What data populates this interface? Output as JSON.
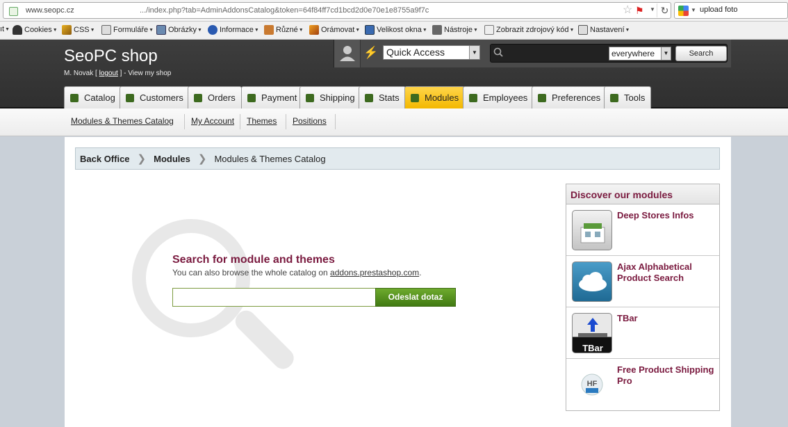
{
  "browser": {
    "url_host": "www.seopc.cz",
    "url_path": ".../index.php?tab=AdminAddonsCatalog&token=64f84ff7cd1bcd2d0e70e1e8755a9f7c",
    "search_text": "upload foto"
  },
  "toolbar": {
    "items": [
      "Cookies",
      "CSS",
      "Formuláře",
      "Obrázky",
      "Informace",
      "Různé",
      "Orámovat",
      "Velikost okna",
      "Nástroje",
      "Zobrazit zdrojový kód",
      "Nastavení"
    ],
    "lead": "ıt"
  },
  "header": {
    "shop_name": "SeoPC shop",
    "user_name": "M. Novak",
    "logout": "logout",
    "view_shop": "- View my shop",
    "quick_access": "Quick Access",
    "search_scope": "everywhere",
    "search_button": "Search"
  },
  "tabs": [
    {
      "label": "Catalog",
      "active": false
    },
    {
      "label": "Customers",
      "active": false
    },
    {
      "label": "Orders",
      "active": false
    },
    {
      "label": "Payment",
      "active": false
    },
    {
      "label": "Shipping",
      "active": false
    },
    {
      "label": "Stats",
      "active": false
    },
    {
      "label": "Modules",
      "active": true
    },
    {
      "label": "Employees",
      "active": false
    },
    {
      "label": "Preferences",
      "active": false
    },
    {
      "label": "Tools",
      "active": false
    }
  ],
  "subtabs": [
    "Modules & Themes Catalog",
    "My Account",
    "Themes",
    "Positions"
  ],
  "breadcrumb": {
    "root": "Back Office",
    "section": "Modules",
    "current": "Modules & Themes Catalog"
  },
  "catalog_search": {
    "title": "Search for module and themes",
    "subtitle_prefix": "You can also browse the whole catalog on ",
    "subtitle_link": "addons.prestashop.com",
    "subtitle_suffix": ".",
    "input_value": "",
    "submit_label": "Odeslat dotaz"
  },
  "discover": {
    "title": "Discover our modules",
    "modules": [
      {
        "name": "Deep Stores Infos",
        "icon": "store-building-icon"
      },
      {
        "name": "Ajax Alphabetical Product Search",
        "icon": "cloud-icon"
      },
      {
        "name": "TBar",
        "icon": "tbar-upload-icon"
      },
      {
        "name": "Free Product Shipping Pro",
        "icon": "shipping-truck-icon"
      }
    ]
  },
  "colors": {
    "accent_maroon": "#7a1a3f",
    "active_tab": "#f3b800",
    "submit_green": "#5a9a22"
  }
}
